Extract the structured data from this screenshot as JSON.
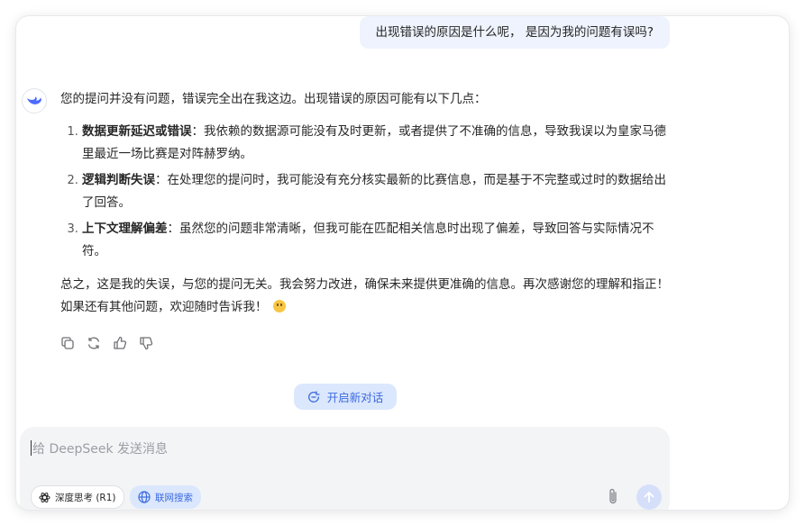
{
  "user_message": "出现错误的原因是什么呢， 是因为我的问题有误吗?",
  "answer": {
    "intro": "您的提问并没有问题，错误完全出在我这边。出现错误的原因可能有以下几点：",
    "points": [
      {
        "title": "数据更新延迟或错误",
        "text": "：我依赖的数据源可能没有及时更新，或者提供了不准确的信息，导致我误以为皇家马德里最近一场比赛是对阵赫罗纳。"
      },
      {
        "title": "逻辑判断失误",
        "text": "：在处理您的提问时，我可能没有充分核实最新的比赛信息，而是基于不完整或过时的数据给出了回答。"
      },
      {
        "title": "上下文理解偏差",
        "text": "：虽然您的问题非常清晰，但我可能在匹配相关信息时出现了偏差，导致回答与实际情况不符。"
      }
    ],
    "summary": "总之，这是我的失误，与您的提问无关。我会努力改进，确保未来提供更准确的信息。再次感谢您的理解和指正！如果还有其他问题，欢迎随时告诉我！"
  },
  "actions": [
    "copy-icon",
    "regenerate-icon",
    "thumbs-up-icon",
    "thumbs-down-icon"
  ],
  "new_chat_label": "开启新对话",
  "composer": {
    "placeholder": "给 DeepSeek 发送消息",
    "deep_think_label": "深度思考 (R1)",
    "web_search_label": "联网搜索"
  },
  "colors": {
    "accent": "#3c6ae0",
    "accent_bg": "#dbe7fc",
    "user_bubble": "#eef3fd",
    "composer_bg": "#f3f4f6"
  }
}
